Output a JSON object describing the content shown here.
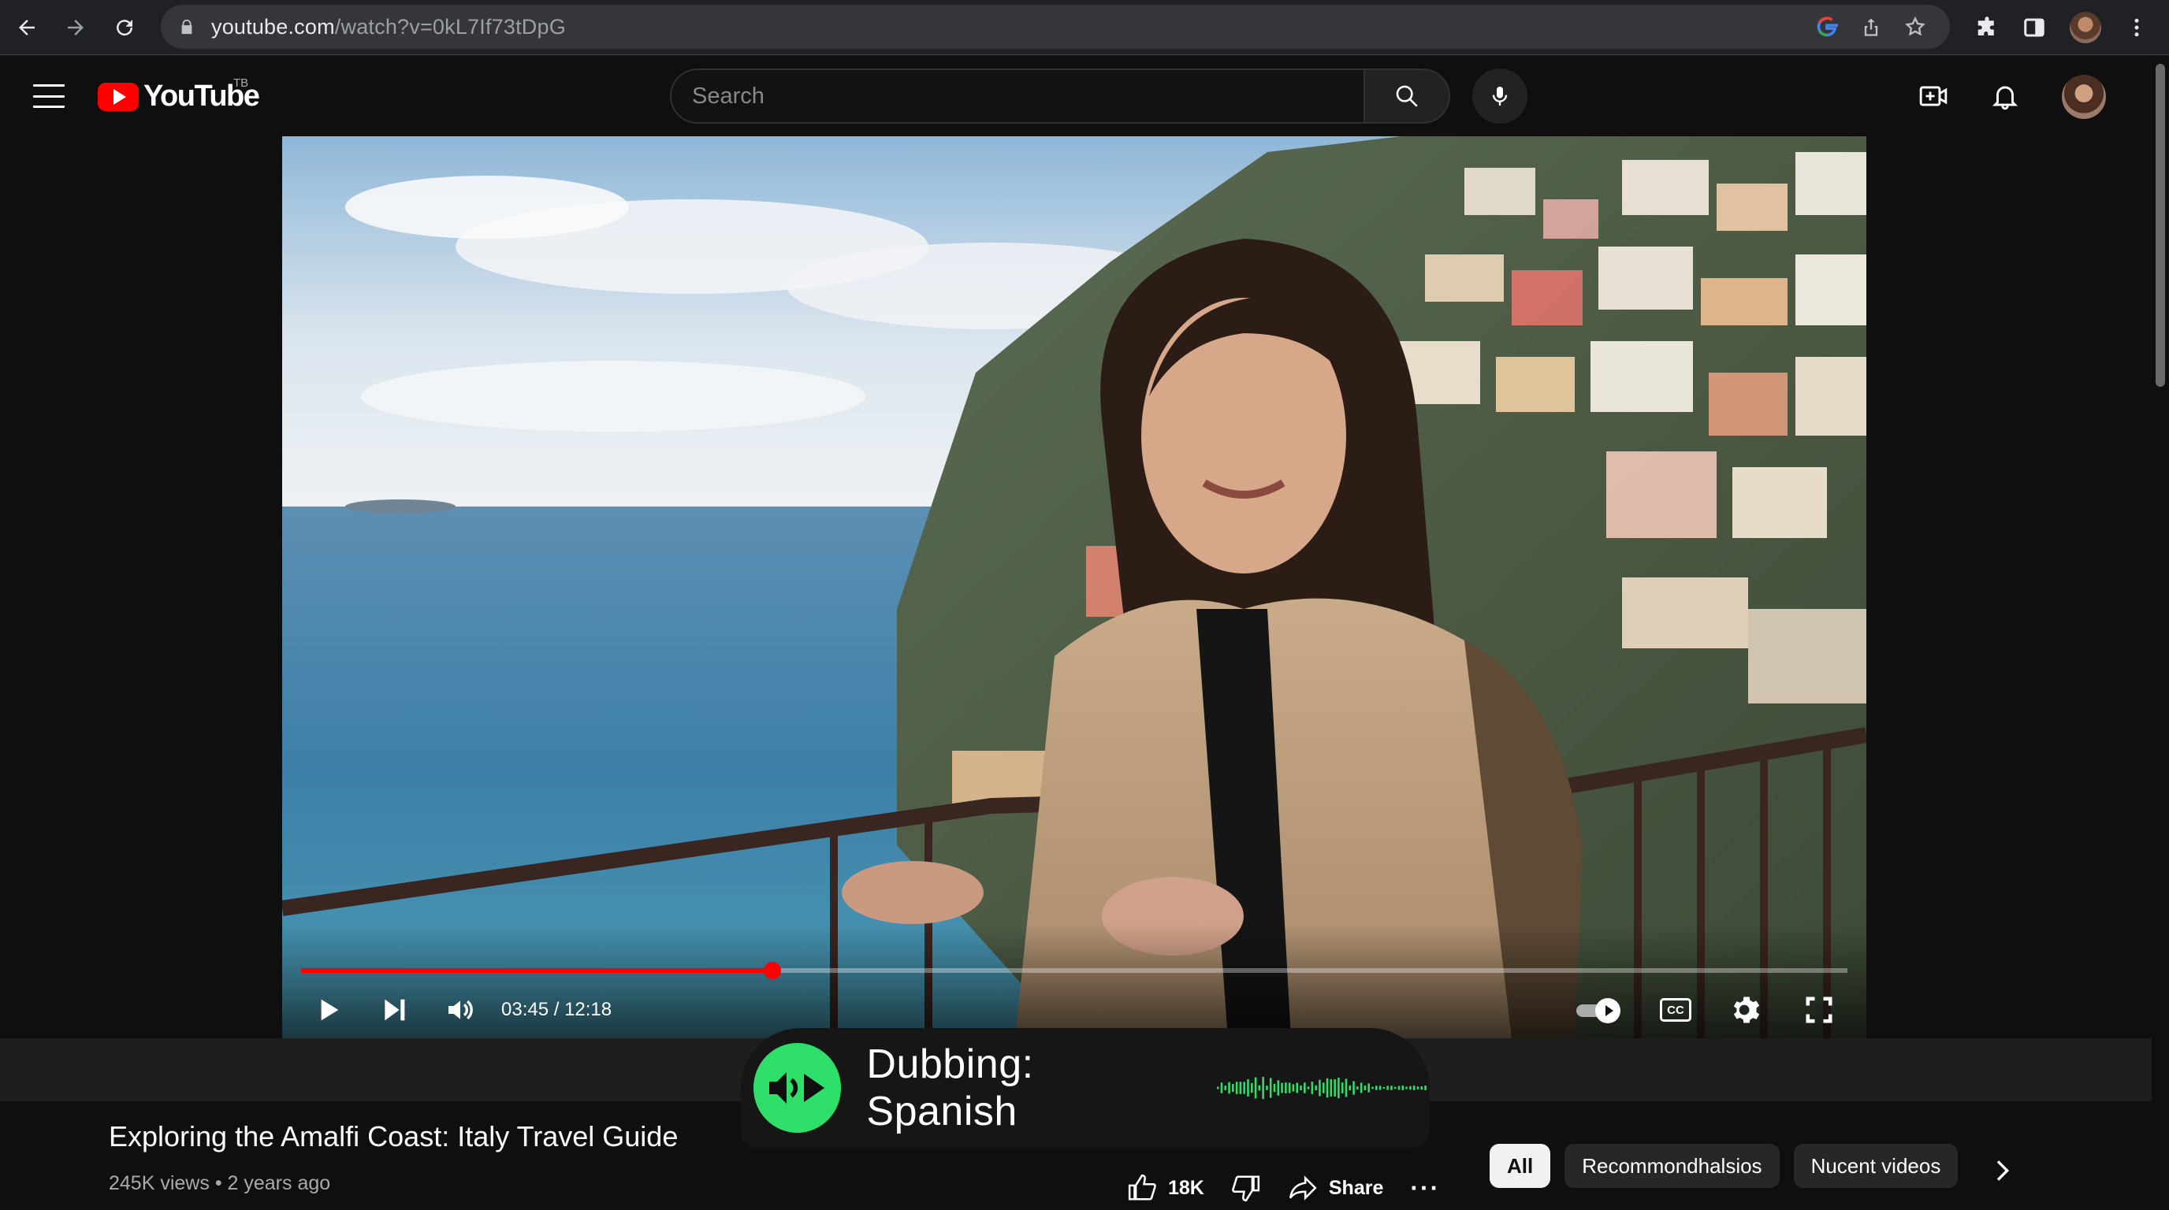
{
  "browser": {
    "url_host": "youtube.com",
    "url_path": "/watch?v=0kL7If73tDpG"
  },
  "header": {
    "logo_text": "YouTube",
    "logo_country": "TB",
    "search_placeholder": "Search"
  },
  "player": {
    "time": "03:45 / 12:18",
    "progress_fraction": 0.305,
    "cc_label": "CC"
  },
  "dubbing": {
    "label": "Dubbing: Spanish",
    "accent_color": "#2ee06a"
  },
  "video": {
    "title": "Exploring the Amalfi Coast: Italy Travel Guide",
    "views": "245K views",
    "age": "2 years ago",
    "likes": "18K",
    "share_label": "Share",
    "more_label": "···"
  },
  "chips": [
    {
      "label": "All",
      "active": true
    },
    {
      "label": "Recommondhalsios",
      "active": false
    },
    {
      "label": "Nucent videos",
      "active": false
    }
  ],
  "colors": {
    "progress": "#ff0000",
    "logo_red": "#ff0000",
    "background": "#0f0f0f"
  }
}
